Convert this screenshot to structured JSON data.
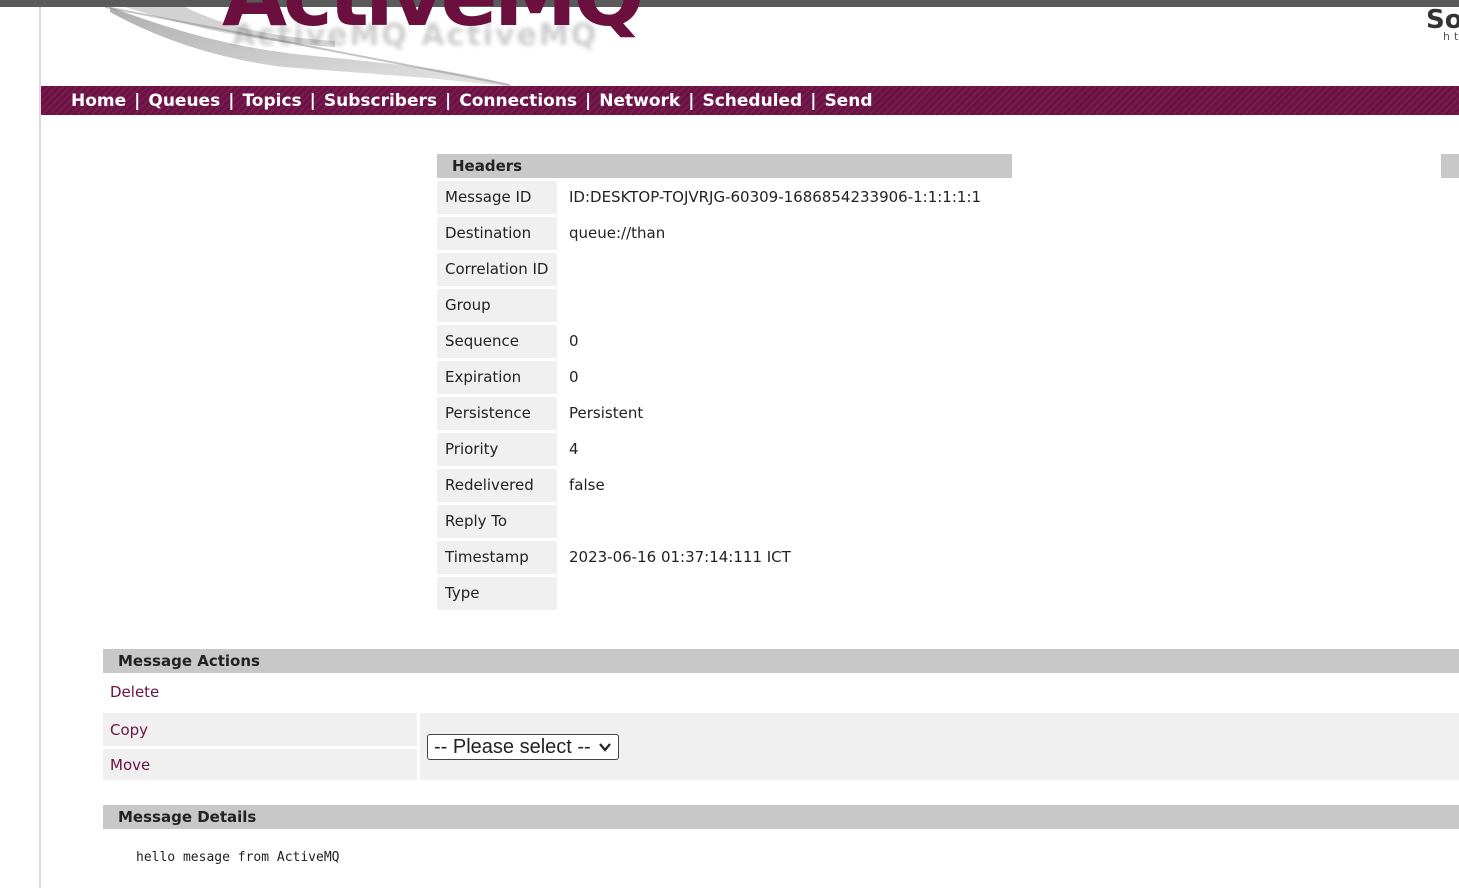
{
  "banner": {
    "logo_text": "ActiveMQ",
    "corner_text": "So",
    "corner_sub": "ht"
  },
  "nav": {
    "items": [
      "Home",
      "Queues",
      "Topics",
      "Subscribers",
      "Connections",
      "Network",
      "Scheduled",
      "Send"
    ],
    "separator": "|"
  },
  "headers": {
    "title": "Headers",
    "rows": [
      {
        "label": "Message ID",
        "value": "ID:DESKTOP-TOJVRJG-60309-1686854233906-1:1:1:1:1"
      },
      {
        "label": "Destination",
        "value": "queue://than"
      },
      {
        "label": "Correlation ID",
        "value": ""
      },
      {
        "label": "Group",
        "value": ""
      },
      {
        "label": "Sequence",
        "value": "0"
      },
      {
        "label": "Expiration",
        "value": "0"
      },
      {
        "label": "Persistence",
        "value": "Persistent"
      },
      {
        "label": "Priority",
        "value": "4"
      },
      {
        "label": "Redelivered",
        "value": "false"
      },
      {
        "label": "Reply To",
        "value": ""
      },
      {
        "label": "Timestamp",
        "value": "2023-06-16 01:37:14:111 ICT"
      },
      {
        "label": "Type",
        "value": ""
      }
    ]
  },
  "actions": {
    "title": "Message Actions",
    "delete_label": "Delete",
    "copy_label": "Copy",
    "move_label": "Move",
    "select_value": "-- Please select --"
  },
  "details": {
    "title": "Message Details",
    "body": "hello mesage from ActiveMQ"
  },
  "colors": {
    "nav_bg": "#6d1144",
    "link": "#6d1144",
    "section_header": "#c8c8c8",
    "cell_bg": "#f0f0f0"
  }
}
